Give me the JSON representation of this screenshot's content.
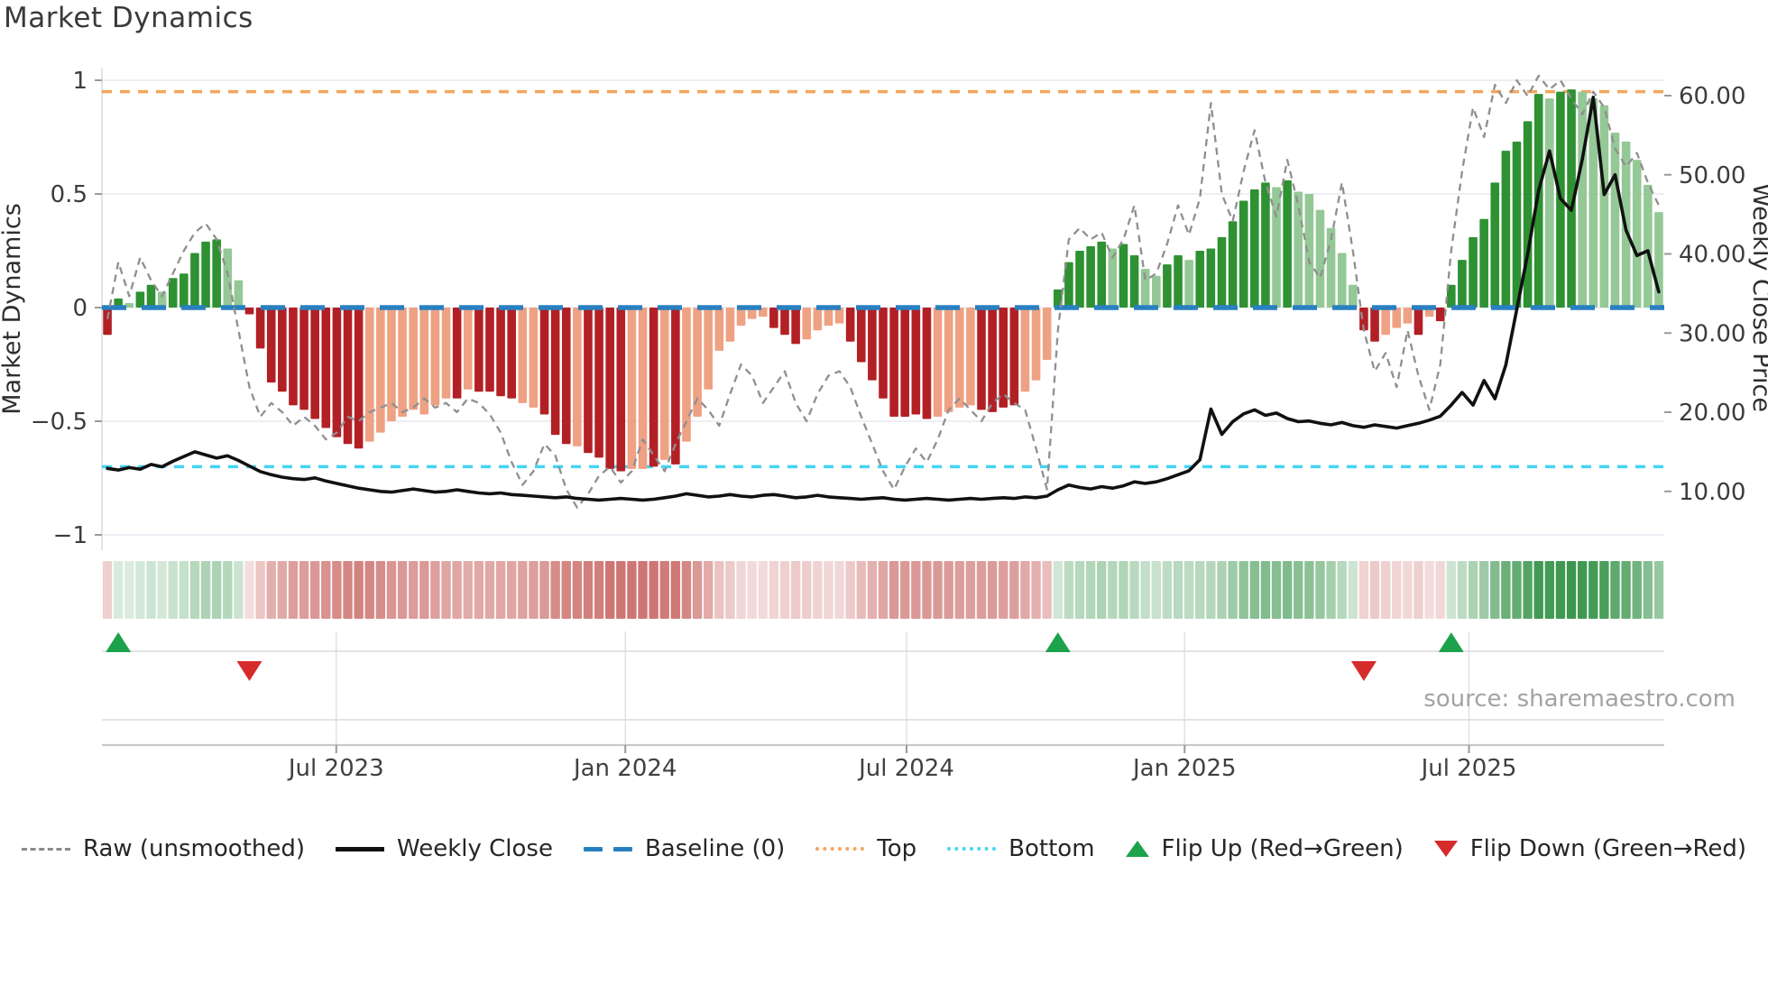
{
  "title": "Market Dynamics",
  "source": "source: sharemaestro.com",
  "axes": {
    "left": {
      "label": "Market Dynamics",
      "ticks": [
        {
          "v": 1,
          "label": "1"
        },
        {
          "v": 0.5,
          "label": "0.5"
        },
        {
          "v": 0,
          "label": "0"
        },
        {
          "v": -0.5,
          "label": "−0.5"
        },
        {
          "v": -1,
          "label": "−1"
        }
      ]
    },
    "right": {
      "label": "Weekly Close Price",
      "ticks": [
        {
          "v": 60,
          "label": "60.00"
        },
        {
          "v": 50,
          "label": "50.00"
        },
        {
          "v": 40,
          "label": "40.00"
        },
        {
          "v": 30,
          "label": "30.00"
        },
        {
          "v": 20,
          "label": "20.00"
        },
        {
          "v": 10,
          "label": "10.00"
        }
      ]
    },
    "x": {
      "ticks": [
        {
          "label": "Jul 2023",
          "frac": 0.15
        },
        {
          "label": "Jan 2024",
          "frac": 0.335
        },
        {
          "label": "Jul 2024",
          "frac": 0.515
        },
        {
          "label": "Jan 2025",
          "frac": 0.693
        },
        {
          "label": "Jul 2025",
          "frac": 0.875
        }
      ]
    }
  },
  "legend": [
    {
      "id": "raw",
      "label": "Raw (unsmoothed)",
      "color": "#8a8a8a"
    },
    {
      "id": "close",
      "label": "Weekly Close",
      "color": "#111111"
    },
    {
      "id": "baseline",
      "label": "Baseline (0)",
      "color": "#2980c0"
    },
    {
      "id": "top",
      "label": "Top",
      "color": "#f2a65e"
    },
    {
      "id": "bottom",
      "label": "Bottom",
      "color": "#45d4f2"
    },
    {
      "id": "flip-up",
      "label": "Flip Up (Red→Green)",
      "color": "#1da24c"
    },
    {
      "id": "flip-down",
      "label": "Flip Down (Green→Red)",
      "color": "#d62b2b"
    }
  ],
  "colors": {
    "pos_strong": "#2e9132",
    "pos_soft": "#94c896",
    "neg_strong": "#b22025",
    "neg_soft": "#efa183",
    "baseline": "#2980c0",
    "top_line": "#f2a65e",
    "bottom_line": "#45d4f2",
    "raw_line": "#8f8f8f",
    "close_line": "#111111",
    "grid": "#e9e9f2",
    "heat_pos": "40,140,60",
    "heat_neg": "185,60,55",
    "flip_up": "#1da24c",
    "flip_down": "#d62b2b"
  },
  "chart_data": {
    "type": "bar",
    "subtype": "weekly oscillator bars + weekly close price line + raw dashed line + heatmap strip + flip markers",
    "n_weeks": 143,
    "x_range": "Feb 2023 – Nov 2025 (weekly)",
    "ylim_left": [
      -1,
      1
    ],
    "ylim_right_price": [
      10,
      60
    ],
    "grid": "horizontal at left-axis ticks",
    "legend_position": "bottom center",
    "reference_lines": {
      "baseline": 0,
      "top": 0.95,
      "bottom": -0.7
    },
    "oscillator_values": [
      -0.12,
      0.04,
      0.02,
      0.07,
      0.1,
      0.07,
      0.13,
      0.15,
      0.24,
      0.29,
      0.3,
      0.26,
      0.12,
      -0.03,
      -0.18,
      -0.33,
      -0.37,
      -0.43,
      -0.45,
      -0.49,
      -0.53,
      -0.57,
      -0.6,
      -0.62,
      -0.59,
      -0.55,
      -0.5,
      -0.48,
      -0.45,
      -0.47,
      -0.43,
      -0.4,
      -0.4,
      -0.36,
      -0.37,
      -0.37,
      -0.39,
      -0.4,
      -0.42,
      -0.44,
      -0.47,
      -0.56,
      -0.6,
      -0.61,
      -0.64,
      -0.66,
      -0.71,
      -0.72,
      -0.71,
      -0.71,
      -0.7,
      -0.67,
      -0.69,
      -0.59,
      -0.48,
      -0.36,
      -0.19,
      -0.15,
      -0.08,
      -0.05,
      -0.04,
      -0.09,
      -0.12,
      -0.16,
      -0.14,
      -0.1,
      -0.08,
      -0.07,
      -0.15,
      -0.24,
      -0.32,
      -0.4,
      -0.48,
      -0.48,
      -0.47,
      -0.49,
      -0.48,
      -0.46,
      -0.44,
      -0.43,
      -0.45,
      -0.46,
      -0.44,
      -0.43,
      -0.37,
      -0.32,
      -0.23,
      0.08,
      0.2,
      0.25,
      0.27,
      0.29,
      0.26,
      0.28,
      0.23,
      0.17,
      0.14,
      0.19,
      0.23,
      0.21,
      0.25,
      0.26,
      0.31,
      0.38,
      0.47,
      0.52,
      0.55,
      0.53,
      0.56,
      0.51,
      0.5,
      0.43,
      0.35,
      0.24,
      0.1,
      -0.1,
      -0.15,
      -0.12,
      -0.09,
      -0.07,
      -0.12,
      -0.04,
      -0.06,
      0.1,
      0.21,
      0.31,
      0.39,
      0.55,
      0.69,
      0.73,
      0.82,
      0.94,
      0.92,
      0.95,
      0.96,
      0.95,
      0.92,
      0.89,
      0.77,
      0.73,
      0.65,
      0.54,
      0.42
    ],
    "bar_shades": [
      "D",
      "D",
      "L",
      "D",
      "D",
      "L",
      "D",
      "D",
      "D",
      "D",
      "D",
      "L",
      "L",
      "D",
      "D",
      "D",
      "D",
      "D",
      "D",
      "D",
      "D",
      "D",
      "D",
      "D",
      "L",
      "L",
      "L",
      "L",
      "L",
      "L",
      "L",
      "L",
      "D",
      "L",
      "D",
      "D",
      "D",
      "D",
      "L",
      "L",
      "D",
      "D",
      "D",
      "L",
      "D",
      "D",
      "D",
      "D",
      "L",
      "L",
      "D",
      "L",
      "D",
      "L",
      "L",
      "L",
      "L",
      "L",
      "L",
      "L",
      "L",
      "D",
      "D",
      "D",
      "L",
      "L",
      "L",
      "L",
      "D",
      "D",
      "D",
      "D",
      "D",
      "D",
      "D",
      "D",
      "L",
      "L",
      "L",
      "L",
      "D",
      "D",
      "D",
      "D",
      "L",
      "L",
      "L",
      "D",
      "D",
      "D",
      "D",
      "D",
      "L",
      "D",
      "D",
      "L",
      "L",
      "D",
      "D",
      "L",
      "D",
      "D",
      "D",
      "D",
      "D",
      "D",
      "D",
      "L",
      "D",
      "L",
      "L",
      "L",
      "L",
      "L",
      "L",
      "D",
      "D",
      "L",
      "L",
      "L",
      "D",
      "L",
      "D",
      "D",
      "D",
      "D",
      "D",
      "D",
      "D",
      "D",
      "D",
      "D",
      "L",
      "D",
      "D",
      "L",
      "L",
      "L",
      "L",
      "L",
      "L",
      "L",
      "L"
    ],
    "raw_values": [
      -0.05,
      0.2,
      0.05,
      0.22,
      0.12,
      0.05,
      0.15,
      0.25,
      0.33,
      0.37,
      0.3,
      0.15,
      -0.1,
      -0.35,
      -0.48,
      -0.42,
      -0.46,
      -0.52,
      -0.48,
      -0.52,
      -0.58,
      -0.55,
      -0.48,
      -0.5,
      -0.46,
      -0.44,
      -0.42,
      -0.46,
      -0.44,
      -0.4,
      -0.44,
      -0.42,
      -0.46,
      -0.4,
      -0.42,
      -0.47,
      -0.55,
      -0.68,
      -0.78,
      -0.72,
      -0.6,
      -0.65,
      -0.8,
      -0.88,
      -0.82,
      -0.74,
      -0.7,
      -0.77,
      -0.72,
      -0.58,
      -0.65,
      -0.72,
      -0.6,
      -0.5,
      -0.4,
      -0.45,
      -0.52,
      -0.38,
      -0.25,
      -0.3,
      -0.42,
      -0.35,
      -0.28,
      -0.42,
      -0.5,
      -0.38,
      -0.3,
      -0.28,
      -0.35,
      -0.48,
      -0.6,
      -0.72,
      -0.8,
      -0.7,
      -0.62,
      -0.68,
      -0.58,
      -0.45,
      -0.4,
      -0.45,
      -0.5,
      -0.42,
      -0.38,
      -0.42,
      -0.45,
      -0.62,
      -0.8,
      -0.1,
      0.3,
      0.35,
      0.3,
      0.33,
      0.22,
      0.3,
      0.45,
      0.12,
      0.15,
      0.28,
      0.45,
      0.32,
      0.48,
      0.9,
      0.5,
      0.38,
      0.6,
      0.78,
      0.55,
      0.4,
      0.65,
      0.45,
      0.2,
      0.13,
      0.3,
      0.55,
      0.25,
      -0.1,
      -0.28,
      -0.2,
      -0.35,
      -0.1,
      -0.3,
      -0.45,
      -0.25,
      0.25,
      0.6,
      0.88,
      0.75,
      0.98,
      0.9,
      1.0,
      0.93,
      1.02,
      0.96,
      1.0,
      0.92,
      0.85,
      0.95,
      0.88,
      0.7,
      0.62,
      0.68,
      0.55,
      0.45
    ],
    "weekly_close_price": [
      12.9,
      12.7,
      13.0,
      12.8,
      13.4,
      13.1,
      13.8,
      14.4,
      15.0,
      14.6,
      14.2,
      14.5,
      13.9,
      13.2,
      12.5,
      12.1,
      11.8,
      11.6,
      11.5,
      11.7,
      11.3,
      11.0,
      10.7,
      10.4,
      10.2,
      10.0,
      9.9,
      10.1,
      10.3,
      10.1,
      9.9,
      10.0,
      10.2,
      10.0,
      9.8,
      9.7,
      9.8,
      9.6,
      9.5,
      9.4,
      9.3,
      9.2,
      9.3,
      9.1,
      9.0,
      8.9,
      9.0,
      9.1,
      9.0,
      8.9,
      9.0,
      9.2,
      9.4,
      9.7,
      9.5,
      9.3,
      9.4,
      9.6,
      9.4,
      9.3,
      9.5,
      9.6,
      9.4,
      9.2,
      9.3,
      9.5,
      9.3,
      9.2,
      9.1,
      9.0,
      9.1,
      9.2,
      9.0,
      8.9,
      9.0,
      9.1,
      9.0,
      8.9,
      9.0,
      9.1,
      9.0,
      9.1,
      9.2,
      9.1,
      9.3,
      9.2,
      9.4,
      10.2,
      10.8,
      10.5,
      10.3,
      10.6,
      10.4,
      10.7,
      11.2,
      11.0,
      11.2,
      11.6,
      12.1,
      12.6,
      14.0,
      20.4,
      17.2,
      18.8,
      19.8,
      20.3,
      19.6,
      19.9,
      19.2,
      18.8,
      18.9,
      18.6,
      18.4,
      18.7,
      18.3,
      18.1,
      18.4,
      18.2,
      18.0,
      18.3,
      18.6,
      19.0,
      19.5,
      20.9,
      22.5,
      20.9,
      24.0,
      21.7,
      26.0,
      33.0,
      40.0,
      48.0,
      53.0,
      47.0,
      45.5,
      52.0,
      59.8,
      47.5,
      50.0,
      43.0,
      39.8,
      40.4,
      35.2
    ],
    "flip_markers": [
      {
        "dir": "up",
        "week": 1
      },
      {
        "dir": "down",
        "week": 13
      },
      {
        "dir": "up",
        "week": 87
      },
      {
        "dir": "down",
        "week": 115
      },
      {
        "dir": "up",
        "week": 123
      }
    ],
    "heatmap": "strip below main plot; one cell per week; green for positive, red for negative, intensity proportional to |oscillator value|"
  }
}
